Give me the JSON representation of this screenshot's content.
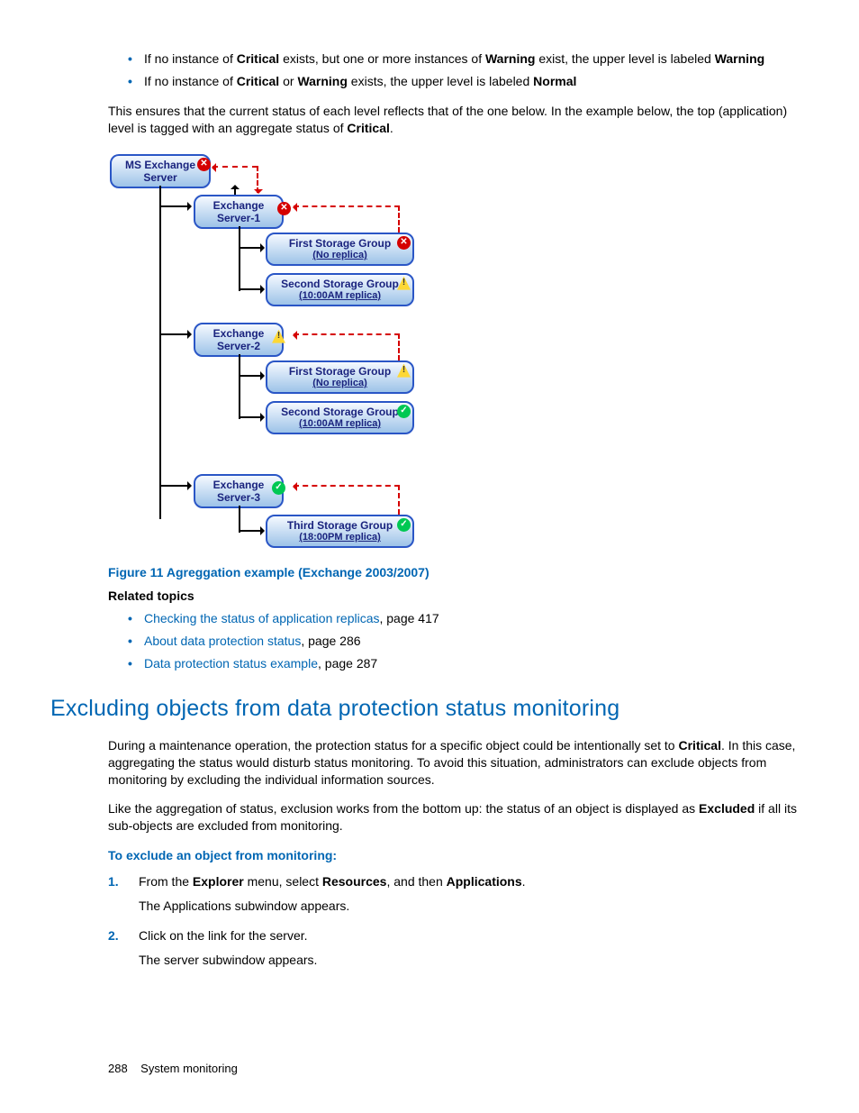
{
  "bullets_top": [
    {
      "pre": "If no instance of ",
      "b1": "Critical",
      "mid": " exists, but one or more instances of ",
      "b2": "Warning",
      "mid2": " exist, the upper level is labeled ",
      "b3": "Warning"
    },
    {
      "pre": "If no instance of ",
      "b1": "Critical",
      "mid": " or ",
      "b2": "Warning",
      "mid2": " exists, the upper level is labeled ",
      "b3": "Normal"
    }
  ],
  "intro_para_1": "This ensures that the current status of each level reflects that of the one below. In the example below, the top (application) level is tagged with an aggregate status of ",
  "intro_para_1b": "Critical",
  "intro_para_1c": ".",
  "diagram": {
    "root": {
      "l1": "MS Exchange",
      "l2": "Server",
      "status": "critical"
    },
    "srv1": {
      "l1": "Exchange",
      "l2": "Server-1",
      "status": "critical"
    },
    "srv1_sg1": {
      "l1": "First Storage Group",
      "sub": "(No replica)",
      "status": "critical"
    },
    "srv1_sg2": {
      "l1": "Second Storage Group",
      "sub": "(10:00AM replica)",
      "status": "warning"
    },
    "srv2": {
      "l1": "Exchange",
      "l2": "Server-2",
      "status": "warning"
    },
    "srv2_sg1": {
      "l1": "First Storage Group",
      "sub": "(No replica)",
      "status": "warning"
    },
    "srv2_sg2": {
      "l1": "Second Storage Group",
      "sub": "(10:00AM replica)",
      "status": "ok"
    },
    "srv3": {
      "l1": "Exchange",
      "l2": "Server-3",
      "status": "ok"
    },
    "srv3_sg1": {
      "l1": "Third Storage Group",
      "sub": "(18:00PM replica)",
      "status": "ok"
    }
  },
  "figure_caption": "Figure 11 Agreggation example (Exchange 2003/2007)",
  "related_heading": "Related topics",
  "related": [
    {
      "link": "Checking the status of application replicas",
      "page": ", page 417"
    },
    {
      "link": "About data protection status",
      "page": ", page 286"
    },
    {
      "link": "Data protection status example",
      "page": ", page 287"
    }
  ],
  "section_heading": "Excluding objects from data protection status monitoring",
  "sec_para1_a": "During a maintenance operation, the protection status for a specific object could be intentionally set to ",
  "sec_para1_b": "Critical",
  "sec_para1_c": ". In this case, aggregating the status would disturb status monitoring. To avoid this situation, administrators can exclude objects from monitoring by excluding the individual information sources.",
  "sec_para2_a": "Like the aggregation of status, exclusion works from the bottom up: the status of an object is displayed as ",
  "sec_para2_b": "Excluded",
  "sec_para2_c": " if all its sub-objects are excluded from monitoring.",
  "procedure_heading": "To exclude an object from monitoring:",
  "steps": [
    {
      "t1": "From the ",
      "b1": "Explorer",
      "t2": " menu, select ",
      "b2": "Resources",
      "t3": ", and then ",
      "b3": "Applications",
      "t4": ".",
      "result": "The Applications subwindow appears."
    },
    {
      "t1": "Click on the link for the server.",
      "result": "The server subwindow appears."
    }
  ],
  "footer_page": "288",
  "footer_text": "System monitoring"
}
